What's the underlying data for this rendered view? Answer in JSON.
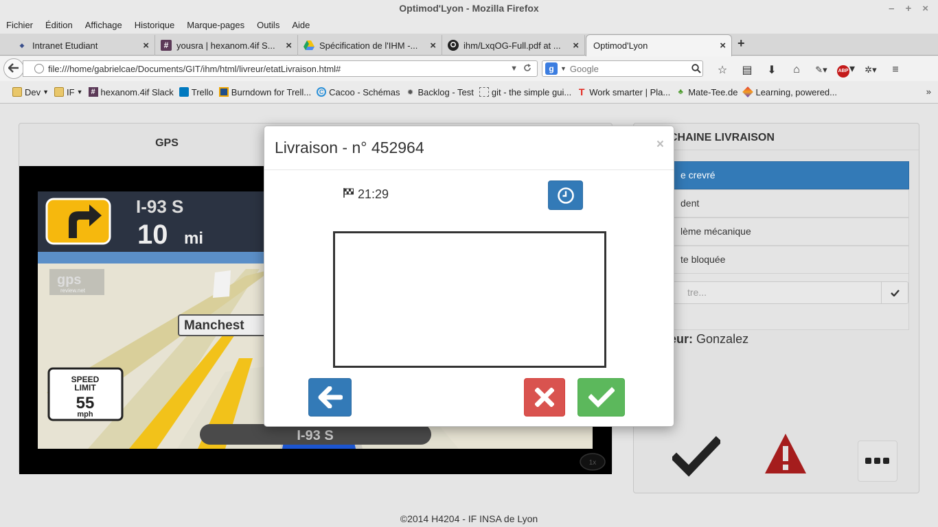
{
  "window": {
    "title": "Optimod'Lyon - Mozilla Firefox",
    "controls": [
      "–",
      "+",
      "×"
    ]
  },
  "menu": {
    "items": [
      "Fichier",
      "Édition",
      "Affichage",
      "Historique",
      "Marque-pages",
      "Outils",
      "Aide"
    ]
  },
  "tabs": [
    {
      "label": "Intranet Etudiant",
      "icon": "insa-icon"
    },
    {
      "label": "yousra | hexanom.4if S...",
      "icon": "slack-icon"
    },
    {
      "label": "Spécification de l'IHM -...",
      "icon": "google-drive-icon"
    },
    {
      "label": "ihm/LxqOG-Full.pdf at ...",
      "icon": "github-icon"
    },
    {
      "label": "Optimod'Lyon",
      "icon": ""
    }
  ],
  "newtab_symbol": "+",
  "navbar": {
    "url": "file:///home/gabrielcae/Documents/GIT/ihm/html/livreur/etatLivraison.html#",
    "search_placeholder": "Google",
    "search_engine_letter": "g"
  },
  "bookmarks": [
    {
      "label": "Dev",
      "icon": "folder-icon",
      "dropdown": true
    },
    {
      "label": "IF",
      "icon": "folder-icon",
      "dropdown": true
    },
    {
      "label": "hexanom.4if Slack",
      "icon": "slack-icon"
    },
    {
      "label": "Trello",
      "icon": "trello-icon"
    },
    {
      "label": "Burndown for Trell...",
      "icon": "burndown-icon"
    },
    {
      "label": "Cacoo - Schémas",
      "icon": "cacoo-icon"
    },
    {
      "label": "Backlog - Test",
      "icon": "bug-icon"
    },
    {
      "label": "git - the simple gui...",
      "icon": "dotted-page-icon"
    },
    {
      "label": "Work smarter | Pla...",
      "icon": "tomato-icon"
    },
    {
      "label": "Mate-Tee.de",
      "icon": "leaf-icon"
    },
    {
      "label": "Learning, powered...",
      "icon": "learning-icon"
    }
  ],
  "bookmarks_more": "»",
  "gps": {
    "title": "GPS",
    "road": "I-93 S",
    "distance_value": "10",
    "distance_unit": "mi",
    "city_label": "Manchest",
    "speed_limit_line1": "SPEED",
    "speed_limit_line2": "LIMIT",
    "speed_limit_value": "55",
    "speed_limit_unit": "mph",
    "current_road": "I-93 S",
    "watermark": "gps",
    "watermark_sub": "review.net",
    "zoom_badge": "1x"
  },
  "right_panel": {
    "title_visible": "CHAINE LIVRAISON",
    "incidents": [
      {
        "label": "e crevré",
        "active": true
      },
      {
        "label": "dent",
        "active": false
      },
      {
        "label": "lème mécanique",
        "active": false
      },
      {
        "label": "te bloquée",
        "active": false
      }
    ],
    "other_placeholder": "tre...",
    "driver_label": "eur:",
    "driver_name": "Gonzalez"
  },
  "modal": {
    "title": "Livraison - n° 452964",
    "close_symbol": "×",
    "eta_time": "21:29"
  },
  "footer": {
    "text": "©2014 H4204 - IF INSA de Lyon"
  },
  "colors": {
    "primary": "#337ab7",
    "danger": "#d9534f",
    "success": "#5cb85c",
    "warning_icon": "#a51d1d"
  }
}
